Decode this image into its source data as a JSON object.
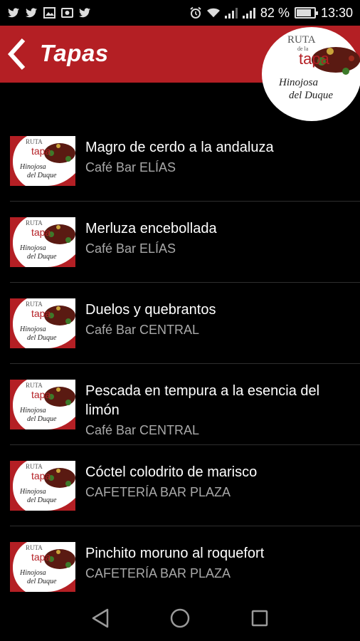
{
  "status_bar": {
    "battery": "82 %",
    "battery_level": 0.82,
    "time": "13:30",
    "left_icons": [
      "twitter-icon",
      "twitter-icon",
      "image-icon",
      "photo-icon",
      "twitter-icon"
    ],
    "right_icons": [
      "alarm-icon",
      "wifi-icon",
      "signal-icon",
      "signal-icon",
      "battery-icon"
    ]
  },
  "app_bar": {
    "title": "Tapas",
    "logo": {
      "line1": "RUTA",
      "line2": "de la",
      "line3": "tapa",
      "line4": "Hinojosa",
      "line5": "del Duque"
    },
    "colors": {
      "primary": "#b41f24"
    }
  },
  "items": [
    {
      "title": "Magro de cerdo a la andaluza",
      "subtitle": "Café Bar ELÍAS"
    },
    {
      "title": "Merluza encebollada",
      "subtitle": "Café Bar ELÍAS"
    },
    {
      "title": "Duelos y quebrantos",
      "subtitle": "Café Bar CENTRAL"
    },
    {
      "title": "Pescada en tempura a la esencia del limón",
      "subtitle": "Café Bar CENTRAL"
    },
    {
      "title": "Cóctel colodrito de marisco",
      "subtitle": "CAFETERÍA BAR PLAZA"
    },
    {
      "title": "Pinchito moruno al roquefort",
      "subtitle": "CAFETERÍA BAR PLAZA"
    }
  ],
  "thumb_logo": {
    "line1": "RUTA",
    "line2": "de la",
    "line3": "tapa",
    "line4": "Hinojosa",
    "line5": "del Duque"
  },
  "nav_bar": {
    "icons": [
      "back-triangle-icon",
      "home-circle-icon",
      "recents-square-icon"
    ]
  }
}
